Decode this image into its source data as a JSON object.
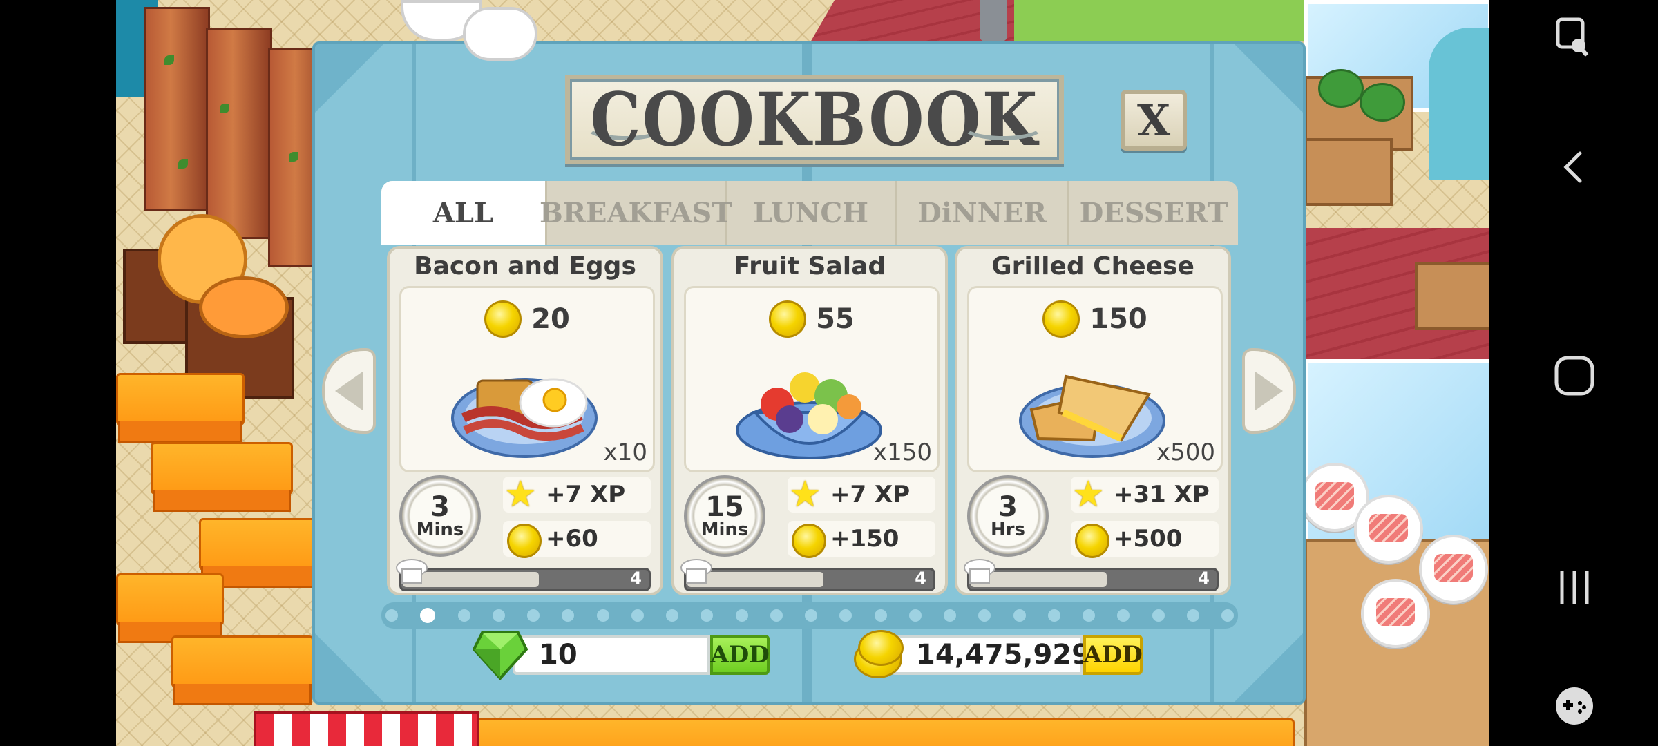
{
  "dialog": {
    "title": "COOKBOOK",
    "close_label": "X",
    "tabs": [
      {
        "label": "ALL",
        "active": true
      },
      {
        "label": "BREAKFAST",
        "active": false
      },
      {
        "label": "LUNCH",
        "active": false
      },
      {
        "label": "DiNNER",
        "active": false
      },
      {
        "label": "DESSERT",
        "active": false
      }
    ],
    "recipes": [
      {
        "name": "Bacon and Eggs",
        "cost": "20",
        "servings": "x10",
        "time_value": "3",
        "time_unit": "Mins",
        "xp": "+7 XP",
        "earnings": "+60",
        "mastery_level": "4",
        "mastery_progress": 0.55
      },
      {
        "name": "Fruit Salad",
        "cost": "55",
        "servings": "x150",
        "time_value": "15",
        "time_unit": "Mins",
        "xp": "+7 XP",
        "earnings": "+150",
        "mastery_level": "4",
        "mastery_progress": 0.55
      },
      {
        "name": "Grilled Cheese",
        "cost": "150",
        "servings": "x500",
        "time_value": "3",
        "time_unit": "Hrs",
        "xp": "+31 XP",
        "earnings": "+500",
        "mastery_level": "4",
        "mastery_progress": 0.55
      }
    ],
    "pager": {
      "total": 25,
      "current": 2
    },
    "gems": {
      "value": "10",
      "add_label": "ADD"
    },
    "coins": {
      "value": "14,475,929",
      "add_label": "ADD"
    }
  },
  "colors": {
    "dialog_bg": "#87c5d8",
    "gem_add": "#8ee03a",
    "coin_add": "#ffe21a",
    "xp_star": "#ffe11a",
    "coin": "#f5d400"
  },
  "icons": {
    "xp": "star-icon",
    "money": "coin-icon",
    "gem": "gem-icon",
    "mastery": "chef-hat-icon",
    "timer": "stopwatch-icon"
  }
}
